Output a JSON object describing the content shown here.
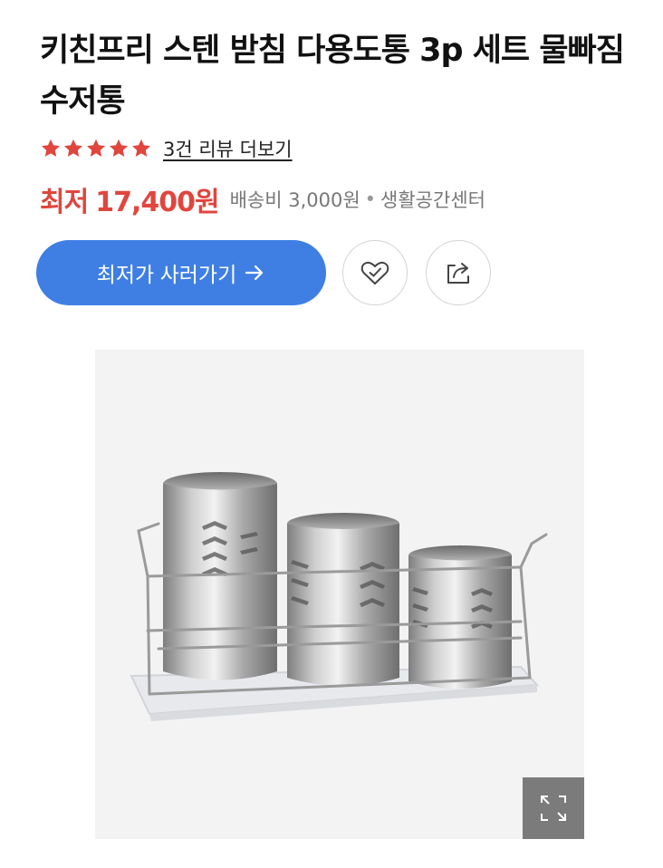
{
  "product": {
    "title": "키친프리 스텐 받침 다용도통 3p 세트 물빠짐 수저통"
  },
  "rating": {
    "stars": 5,
    "max_stars": 5,
    "review_link": "3건 리뷰 더보기"
  },
  "price": {
    "label": "최저",
    "value": "17,400원",
    "shipping": "배송비 3,000원",
    "separator": "•",
    "seller": "생활공간센터",
    "color": "#e0463e"
  },
  "actions": {
    "buy_label": "최저가 사러가기",
    "buy_arrow_icon": "arrow-right-icon",
    "buy_color": "#3f7fe4",
    "wish_icon": "heart-check-icon",
    "share_icon": "share-icon"
  },
  "image": {
    "expand_icon": "expand-icon"
  }
}
